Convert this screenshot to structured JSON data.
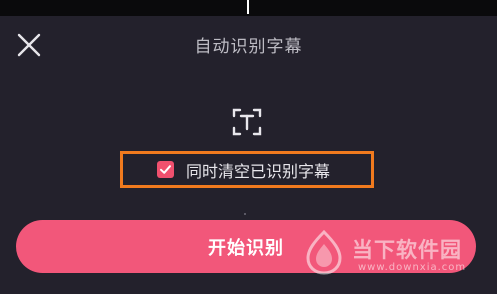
{
  "header": {
    "title": "自动识别字幕",
    "close_icon": "close-icon"
  },
  "main": {
    "text_recognition_icon": "text-recognition-icon",
    "option": {
      "label": "同时清空已识别字幕",
      "checked": true
    },
    "start_button_label": "开始识别"
  },
  "watermark": {
    "logo": "watermark-logo",
    "text": "当下软件园",
    "subtext": "www.downxia.com"
  },
  "colors": {
    "accent": "#f2577a",
    "checkbox": "#f0506e",
    "highlight_border": "#f07a1e",
    "panel_background": "#23212c"
  }
}
